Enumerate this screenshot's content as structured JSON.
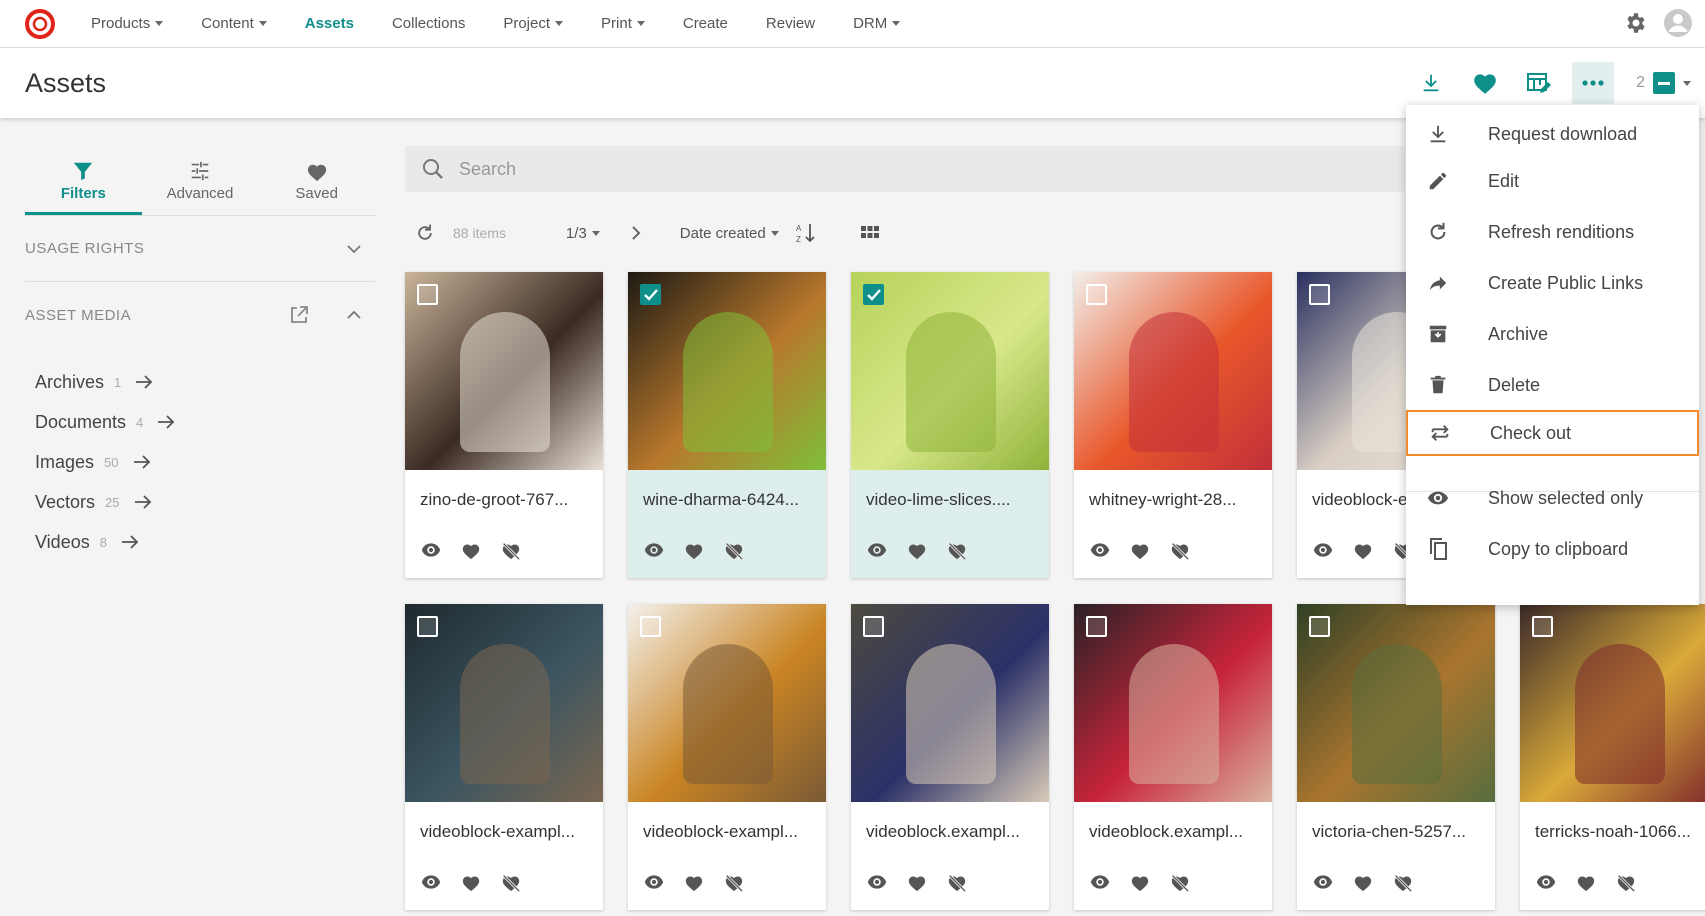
{
  "nav": {
    "items": [
      {
        "label": "Products",
        "caret": true,
        "active": false
      },
      {
        "label": "Content",
        "caret": true,
        "active": false
      },
      {
        "label": "Assets",
        "caret": false,
        "active": true
      },
      {
        "label": "Collections",
        "caret": false,
        "active": false
      },
      {
        "label": "Project",
        "caret": true,
        "active": false
      },
      {
        "label": "Print",
        "caret": true,
        "active": false
      },
      {
        "label": "Create",
        "caret": false,
        "active": false
      },
      {
        "label": "Review",
        "caret": false,
        "active": false
      },
      {
        "label": "DRM",
        "caret": true,
        "active": false
      }
    ]
  },
  "header": {
    "title": "Assets",
    "selected_count": "2"
  },
  "sidebar": {
    "tabs": [
      {
        "label": "Filters",
        "icon": "filter-icon",
        "active": true
      },
      {
        "label": "Advanced",
        "icon": "sliders-icon",
        "active": false
      },
      {
        "label": "Saved",
        "icon": "heart-icon",
        "active": false
      }
    ],
    "sections": {
      "usage_rights": "USAGE RIGHTS",
      "asset_media": "ASSET MEDIA"
    },
    "media": [
      {
        "label": "Archives",
        "count": "1"
      },
      {
        "label": "Documents",
        "count": "4"
      },
      {
        "label": "Images",
        "count": "50"
      },
      {
        "label": "Vectors",
        "count": "25"
      },
      {
        "label": "Videos",
        "count": "8"
      }
    ]
  },
  "search": {
    "placeholder": "Search"
  },
  "toolbar": {
    "items_count": "88 items",
    "page": "1/3",
    "sort": "Date created"
  },
  "assets": [
    {
      "name": "zino-de-groot-767...",
      "selected": false,
      "colors": [
        "#c9b39a",
        "#3a2a22",
        "#e8e0d6"
      ]
    },
    {
      "name": "wine-dharma-6424...",
      "selected": true,
      "colors": [
        "#1d1a14",
        "#b8782c",
        "#7fbf3a"
      ]
    },
    {
      "name": "video-lime-slices....",
      "selected": true,
      "colors": [
        "#b7d25a",
        "#d8e88a",
        "#8fb23a"
      ]
    },
    {
      "name": "whitney-wright-28...",
      "selected": false,
      "colors": [
        "#f2eee9",
        "#e8572a",
        "#c2303a"
      ]
    },
    {
      "name": "videoblock-exampl...",
      "selected": false,
      "colors": [
        "#2a3160",
        "#d9cfc4",
        "#e8e3db"
      ]
    },
    {
      "name": "videoblock-exampl...",
      "selected": false,
      "colors": [
        "#1f2a2e",
        "#3b5561",
        "#7a6651"
      ]
    },
    {
      "name": "videoblock-exampl...",
      "selected": false,
      "colors": [
        "#f4f1ec",
        "#c98423",
        "#7a5a35"
      ]
    },
    {
      "name": "videoblock.exampl...",
      "selected": false,
      "colors": [
        "#4d4a40",
        "#2b3168",
        "#d8cbb8"
      ]
    },
    {
      "name": "videoblock.exampl...",
      "selected": false,
      "colors": [
        "#2a2226",
        "#c8243a",
        "#d9b3a1"
      ]
    },
    {
      "name": "victoria-chen-5257...",
      "selected": false,
      "colors": [
        "#2f4025",
        "#a9752f",
        "#576d3d"
      ]
    },
    {
      "name": "terricks-noah-1066...",
      "selected": false,
      "colors": [
        "#3b2a2a",
        "#d9a93a",
        "#7e2a2a"
      ]
    }
  ],
  "menu": {
    "items": [
      {
        "label": "Request download",
        "icon": "download-icon"
      },
      {
        "label": "Edit",
        "icon": "pencil-icon"
      },
      {
        "label": "Refresh renditions",
        "icon": "refresh-icon"
      },
      {
        "label": "Create Public Links",
        "icon": "share-icon"
      },
      {
        "label": "Archive",
        "icon": "archive-icon"
      },
      {
        "label": "Delete",
        "icon": "trash-icon"
      },
      {
        "label": "Check out",
        "icon": "swap-icon",
        "highlighted": true
      },
      {
        "label": "Show selected only",
        "icon": "eye-icon"
      },
      {
        "label": "Copy to clipboard",
        "icon": "copy-icon"
      }
    ]
  },
  "colors": {
    "accent": "#0f8f8a",
    "highlight": "#f08a2c",
    "selected_bg": "#ddeeed"
  }
}
